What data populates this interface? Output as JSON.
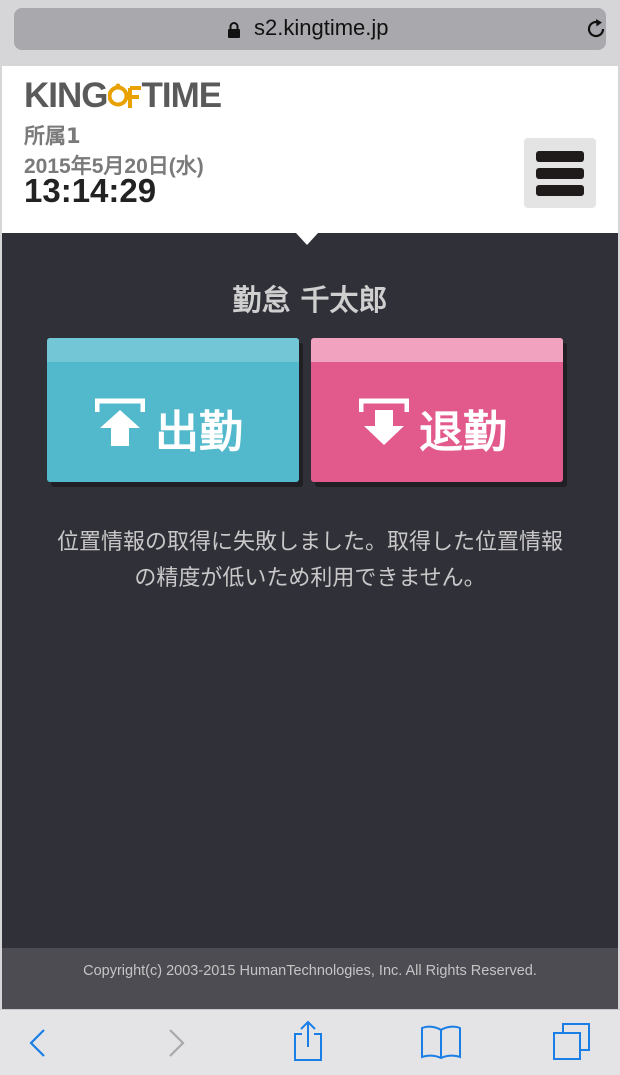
{
  "browser": {
    "url": "s2.kingtime.jp"
  },
  "header": {
    "logo_text": "KING OF TIME",
    "logo_left": "KING",
    "logo_right": "TIME",
    "department": "所属1",
    "date": "2015年5月20日(水)",
    "time": "13:14:29"
  },
  "main": {
    "user_name": "勤怠 千太郎",
    "clock_in_label": "出勤",
    "clock_out_label": "退勤",
    "message_line1": "位置情報の取得に失敗しました。取得した位置情報",
    "message_line2": "の精度が低いため利用できません。"
  },
  "footer": {
    "copyright": "Copyright(c) 2003-2015 HumanTechnologies, Inc. All Rights Reserved."
  },
  "colors": {
    "clock_in": "#52b9cc",
    "clock_out": "#e15a8b",
    "panel_bg": "#303038",
    "ios_blue": "#1a7ee6"
  },
  "icons": [
    "lock-icon",
    "reload-icon",
    "hamburger-menu-icon",
    "arrow-up-icon",
    "arrow-down-icon",
    "back-icon",
    "forward-icon",
    "share-icon",
    "bookmarks-icon",
    "tabs-icon"
  ]
}
